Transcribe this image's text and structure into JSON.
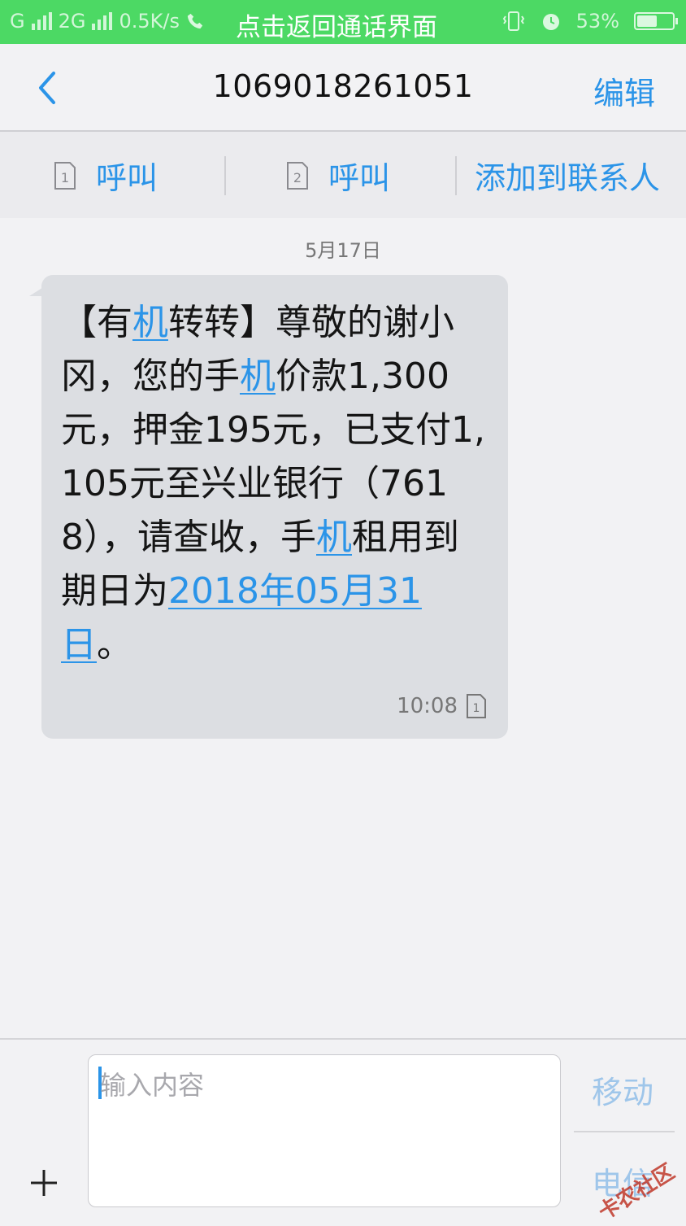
{
  "status_bar": {
    "sim1": "G",
    "sim2": "2G",
    "speed": "0.5K/s",
    "call_banner": "点击返回通话界面",
    "battery": "53%"
  },
  "header": {
    "title": "1069018261051",
    "edit_label": "编辑"
  },
  "actions": {
    "call1_label": "呼叫",
    "call1_sim": "1",
    "call2_label": "呼叫",
    "call2_sim": "2",
    "add_contact_label": "添加到联系人"
  },
  "conversation": {
    "date": "5月17日",
    "message": {
      "text": {
        "p1": "【有",
        "l1": "机",
        "p2": "转转】尊敬的谢小冈，您的手",
        "l2": "机",
        "p3": "价款1,300元，押金195元，已支付1,105元至兴业银行（7618），请查收，手",
        "l3": "机",
        "p4": "租用到期日为",
        "l4": "2018年05月31日",
        "p5": "。"
      },
      "time": "10:08",
      "sim": "1"
    }
  },
  "compose": {
    "placeholder": "输入内容",
    "move_label": "移动",
    "carrier_label": "电信"
  },
  "watermark": "卡农社区",
  "colors": {
    "status_bar": "#4cd964",
    "accent": "#2b94e8",
    "bubble": "#dcdee2",
    "background": "#f2f2f4"
  }
}
